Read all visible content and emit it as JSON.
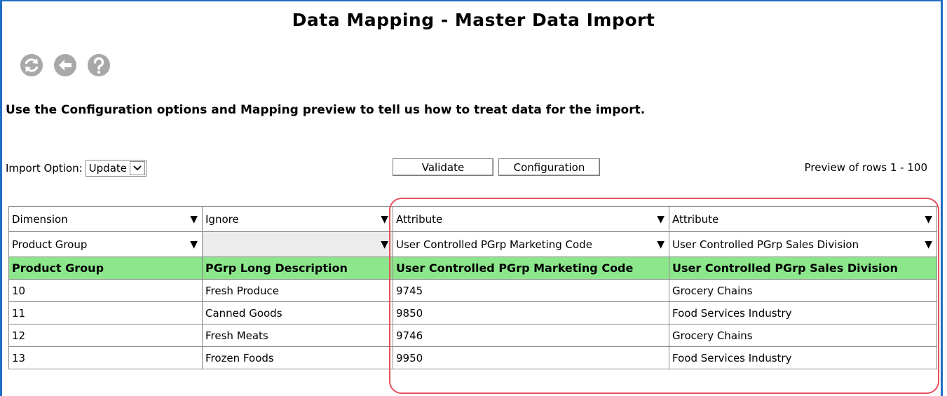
{
  "title": "Data Mapping - Master Data Import",
  "toolbar": {
    "icons": [
      "refresh-icon",
      "back-icon",
      "help-icon"
    ],
    "icon_color": "#a8a8a8"
  },
  "instructions": "Use the Configuration options and Mapping preview to tell us how to treat data for the import.",
  "import_option": {
    "label": "Import Option:",
    "value": "Update"
  },
  "buttons": {
    "validate": "Validate",
    "configuration": "Configuration"
  },
  "preview_text": "Preview of rows 1 - 100",
  "colors": {
    "header_bg": "#8ce68c",
    "highlight": "#e8505b",
    "frame": "#1f6fc4"
  },
  "mapping": {
    "type_row": [
      "Dimension",
      "Ignore",
      "Attribute",
      "Attribute"
    ],
    "target_row": [
      "Product Group",
      "",
      "User Controlled PGrp Marketing Code",
      "User Controlled PGrp Sales Division"
    ],
    "headers": [
      "Product Group",
      "PGrp Long Description",
      "User Controlled PGrp Marketing Code",
      "User Controlled PGrp Sales Division"
    ],
    "rows": [
      [
        "10",
        "Fresh Produce",
        "9745",
        "Grocery Chains"
      ],
      [
        "11",
        "Canned Goods",
        "9850",
        "Food Services Industry"
      ],
      [
        "12",
        "Fresh Meats",
        "9746",
        "Grocery Chains"
      ],
      [
        "13",
        "Frozen Foods",
        "9950",
        "Food Services Industry"
      ]
    ]
  }
}
